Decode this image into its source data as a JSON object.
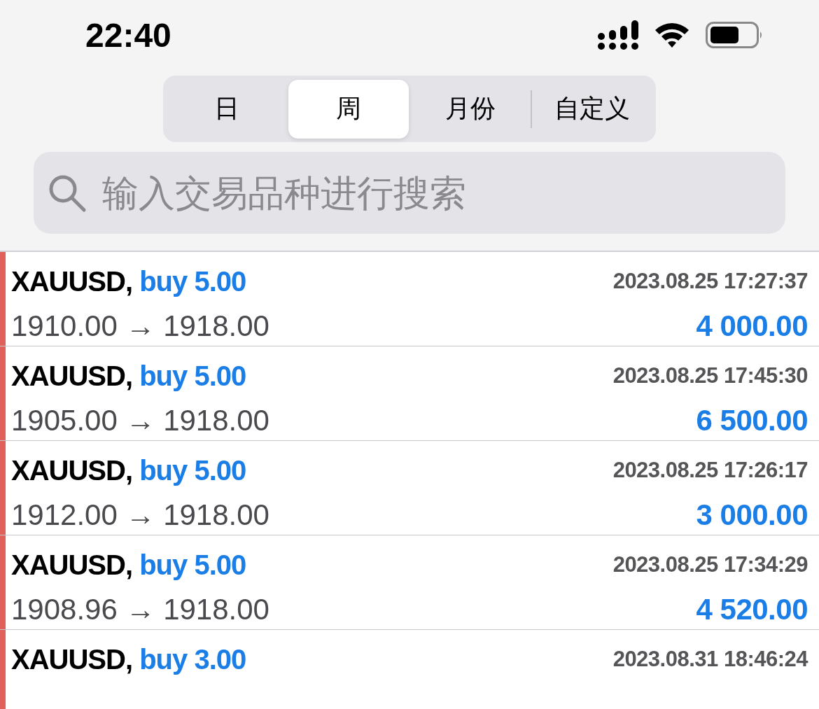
{
  "status_bar": {
    "time": "22:40"
  },
  "tabs": [
    {
      "label": "日",
      "selected": false
    },
    {
      "label": "周",
      "selected": true
    },
    {
      "label": "月份",
      "selected": false
    },
    {
      "label": "自定义",
      "selected": false
    }
  ],
  "search": {
    "placeholder": "输入交易品种进行搜索"
  },
  "trades": [
    {
      "symbol": "XAUUSD,",
      "order": "buy 5.00",
      "time": "2023.08.25 17:27:37",
      "prices": "1910.00 → 1918.00",
      "profit": "4 000.00"
    },
    {
      "symbol": "XAUUSD,",
      "order": "buy 5.00",
      "time": "2023.08.25 17:45:30",
      "prices": "1905.00 → 1918.00",
      "profit": "6 500.00"
    },
    {
      "symbol": "XAUUSD,",
      "order": "buy 5.00",
      "time": "2023.08.25 17:26:17",
      "prices": "1912.00 → 1918.00",
      "profit": "3 000.00"
    },
    {
      "symbol": "XAUUSD,",
      "order": "buy 5.00",
      "time": "2023.08.25 17:34:29",
      "prices": "1908.96 → 1918.00",
      "profit": "4 520.00"
    },
    {
      "symbol": "XAUUSD,",
      "order": "buy 3.00",
      "time": "2023.08.31 18:46:24"
    }
  ]
}
